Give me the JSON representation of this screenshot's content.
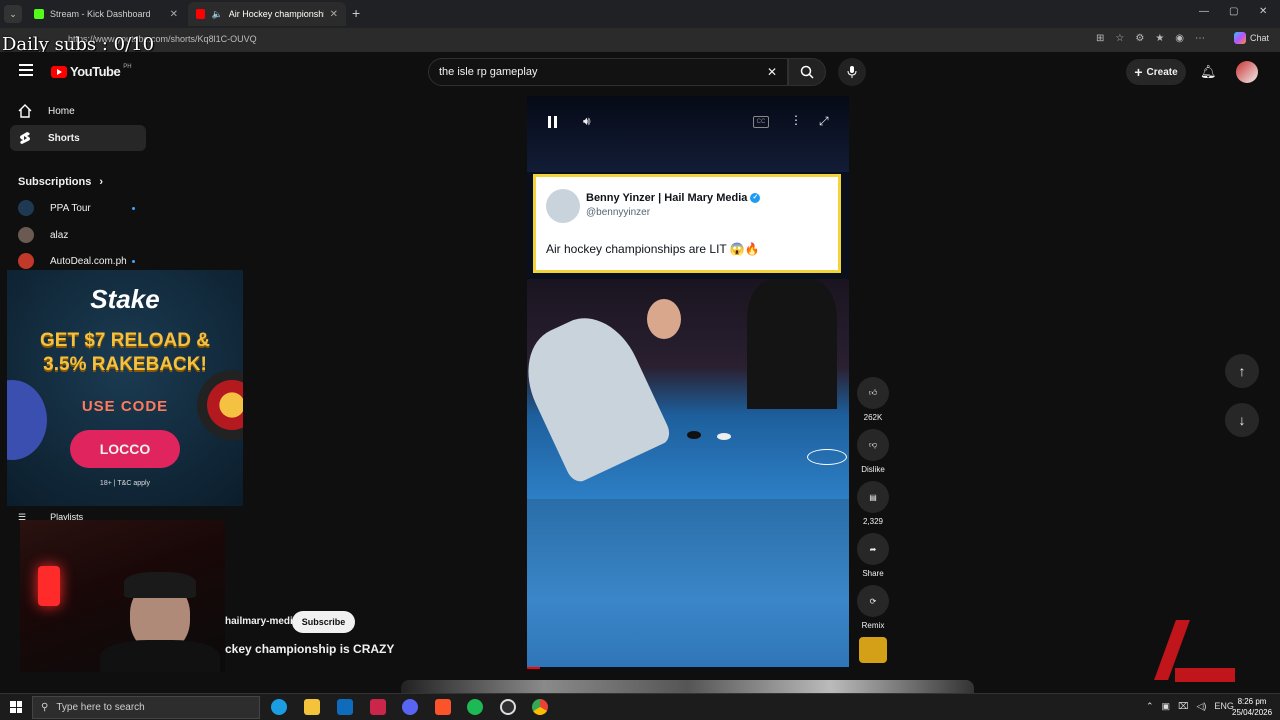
{
  "browser": {
    "tabs": [
      {
        "title": "Stream - Kick Dashboard",
        "active": false
      },
      {
        "title": "Air Hockey championship is C",
        "active": true
      }
    ],
    "url": "https://www.youtube.com/shorts/Kq8l1C-OUVQ",
    "copilot_label": "Chat"
  },
  "overlay": {
    "daily_subs": "Daily subs : 0/10"
  },
  "header": {
    "logo_text": "YouTube",
    "region": "PH",
    "search_value": "the isle rp gameplay",
    "create_label": "Create"
  },
  "sidebar": {
    "items": [
      {
        "label": "Home",
        "active": false
      },
      {
        "label": "Shorts",
        "active": true
      }
    ],
    "subscriptions_title": "Subscriptions",
    "subscriptions": [
      {
        "name": "PPA Tour",
        "new": true
      },
      {
        "name": "alaz",
        "new": false
      },
      {
        "name": "AutoDeal.com.ph",
        "new": true
      }
    ],
    "playlists_label": "Playlists"
  },
  "ad": {
    "brand": "Stake",
    "line1": "GET $7 RELOAD &",
    "line2": "3.5% RAKEBACK!",
    "use_code": "USE CODE",
    "code": "LOCCO",
    "terms": "18+ | T&C apply"
  },
  "short": {
    "tweet": {
      "name": "Benny Yinzer | Hail Mary Media",
      "handle": "@bennyyinzer",
      "text": "Air hockey championships are LIT 😱🔥"
    },
    "channel_partial": "hailmary-media",
    "subscribe_label": "Subscribe",
    "title_partial": "ckey championship is CRAZY",
    "progress": 0.04
  },
  "actions": {
    "likes": "262K",
    "dislike": "Dislike",
    "comments": "2,329",
    "share": "Share",
    "remix": "Remix"
  },
  "taskbar": {
    "search_placeholder": "Type here to search",
    "language": "ENG",
    "time": "8:26 pm",
    "date": "25/04/2026"
  }
}
